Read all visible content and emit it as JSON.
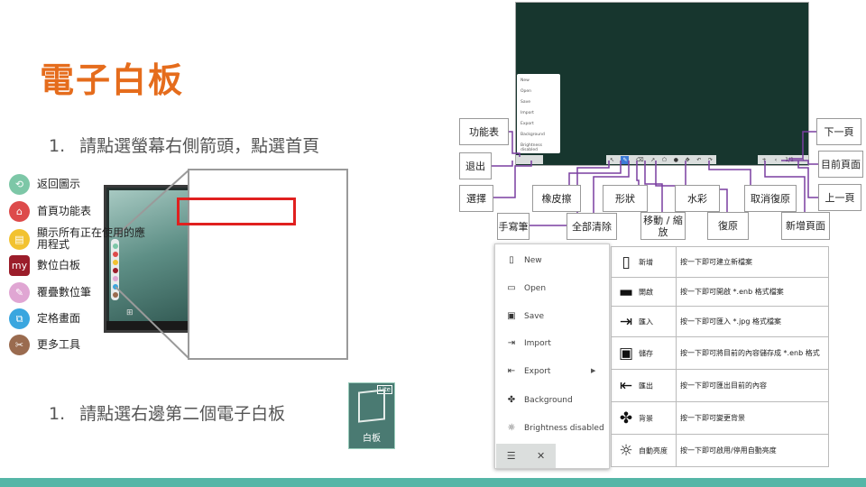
{
  "title": "電子白板",
  "steps": [
    {
      "num": "1.",
      "text": "請點選螢幕右側箭頭，點選首頁"
    },
    {
      "num": "1.",
      "text": "請點選右邊第二個電子白板"
    }
  ],
  "popup_menu": [
    {
      "label": "返回圖示",
      "icon": "back-icon",
      "color": "#7dc7a7",
      "glyph": "⟲"
    },
    {
      "label": "首頁功能表",
      "icon": "home-icon",
      "color": "#dd4b4b",
      "glyph": "⌂"
    },
    {
      "label": "顯示所有正在使用的應用程式",
      "icon": "apps-icon",
      "color": "#f2c230",
      "glyph": "▤"
    },
    {
      "label": "數位白板",
      "icon": "myviewboard-icon",
      "color": "#9b1d2a",
      "glyph": "my"
    },
    {
      "label": "覆疊數位筆",
      "icon": "pen-icon",
      "color": "#e0a6d3",
      "glyph": "✎"
    },
    {
      "label": "定格畫面",
      "icon": "freeze-icon",
      "color": "#3aa6df",
      "glyph": "⧉"
    },
    {
      "label": "更多工具",
      "icon": "tools-icon",
      "color": "#9a6b4f",
      "glyph": "✂"
    }
  ],
  "whiteboard_app_icon": {
    "label": "白板",
    "corner": "Lite"
  },
  "mini_menu": [
    "New",
    "Open",
    "Save",
    "Import",
    "Export",
    "Background",
    "Brightness disabled"
  ],
  "callouts": {
    "function_menu": "功能表",
    "exit": "退出",
    "select": "選擇",
    "handwriting": "手寫筆",
    "eraser": "橡皮擦",
    "clear_all": "全部清除",
    "shape": "形狀",
    "move_zoom": "移動 / 縮放",
    "watercolor": "水彩",
    "redo": "復原",
    "undo": "取消復原",
    "new_page": "新增頁面",
    "next_page": "下一頁",
    "current_page": "目前頁面",
    "prev_page": "上一頁"
  },
  "big_menu": [
    {
      "label": "New",
      "icon": "new-file-icon",
      "glyph": "▯"
    },
    {
      "label": "Open",
      "icon": "open-folder-icon",
      "glyph": "▭"
    },
    {
      "label": "Save",
      "icon": "save-icon",
      "glyph": "▣"
    },
    {
      "label": "Import",
      "icon": "import-icon",
      "glyph": "⇥"
    },
    {
      "label": "Export",
      "icon": "export-icon",
      "glyph": "⇤"
    },
    {
      "label": "Background",
      "icon": "background-icon",
      "glyph": "✤"
    },
    {
      "label": "Brightness disabled",
      "icon": "brightness-icon",
      "glyph": "☼"
    }
  ],
  "big_menu_bar": {
    "menu_glyph": "☰",
    "close_glyph": "✕"
  },
  "table": [
    {
      "icon": "new-file-icon",
      "glyph": "▯",
      "name": "新增",
      "desc": "按一下即可建立新檔案"
    },
    {
      "icon": "open-folder-icon",
      "glyph": "▬",
      "name": "開啟",
      "desc": "按一下即可開啟 *.enb 格式檔案"
    },
    {
      "icon": "import-icon",
      "glyph": "⇥",
      "name": "匯入",
      "desc": "按一下即可匯入 *.jpg 格式檔案"
    },
    {
      "icon": "save-icon",
      "glyph": "▣",
      "name": "儲存",
      "desc": "按一下即可將目前的內容儲存成 *.enb 格式"
    },
    {
      "icon": "export-icon",
      "glyph": "⇤",
      "name": "匯出",
      "desc": "按一下即可匯出目前的內容"
    },
    {
      "icon": "background-icon",
      "glyph": "✤",
      "name": "背景",
      "desc": "按一下即可變更背景"
    },
    {
      "icon": "brightness-icon",
      "glyph": "☼",
      "name": "自動亮度",
      "desc": "按一下即可啟用/停用自動亮度"
    }
  ],
  "colors": {
    "title": "#e56c1c",
    "highlight": "#e0201f",
    "footer": "#55b6a7",
    "callout_line": "#7a3fa0",
    "board": "#17362e"
  }
}
